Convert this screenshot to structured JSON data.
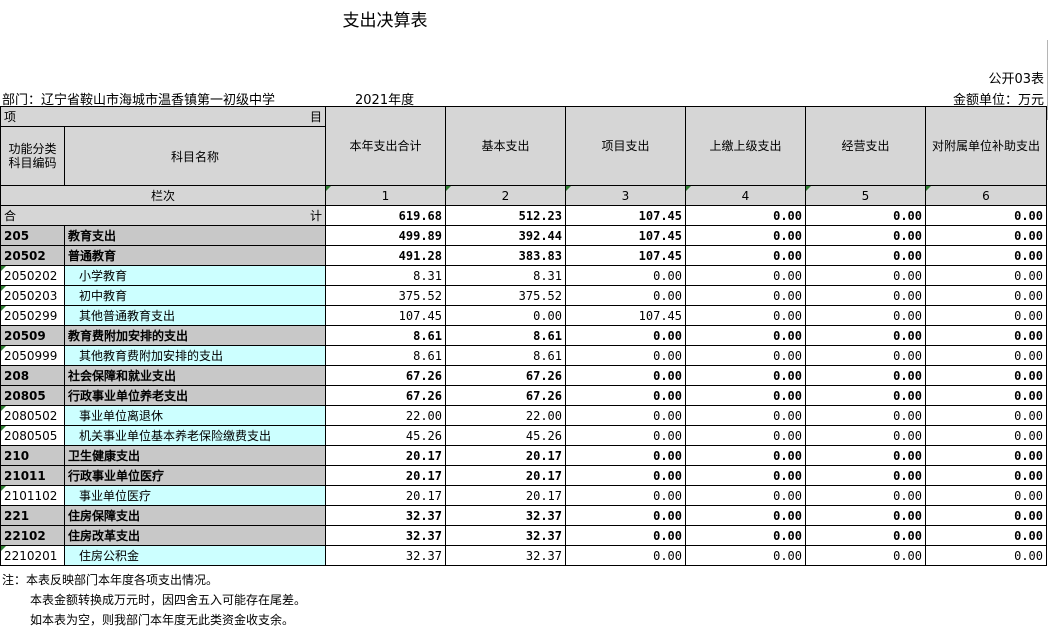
{
  "title": "支出决算表",
  "form_code": "公开03表",
  "department": "部门：辽宁省鞍山市海城市温香镇第一初级中学",
  "year": "2021年度",
  "unit": "金额单位：万元",
  "header": {
    "item_left": "项",
    "item_right": "目",
    "func_code": "功能分类科目编码",
    "subject_name": "科目名称",
    "columns": [
      "本年支出合计",
      "基本支出",
      "项目支出",
      "上缴上级支出",
      "经营支出",
      "对附属单位补助支出"
    ],
    "row_label": "栏次",
    "col_numbers": [
      "1",
      "2",
      "3",
      "4",
      "5",
      "6"
    ]
  },
  "total": {
    "left": "合",
    "right": "计",
    "values": [
      "619.68",
      "512.23",
      "107.45",
      "0.00",
      "0.00",
      "0.00"
    ]
  },
  "rows": [
    {
      "code": "205",
      "name": "教育支出",
      "bold": true,
      "values": [
        "499.89",
        "392.44",
        "107.45",
        "0.00",
        "0.00",
        "0.00"
      ]
    },
    {
      "code": "20502",
      "name": "普通教育",
      "bold": true,
      "values": [
        "491.28",
        "383.83",
        "107.45",
        "0.00",
        "0.00",
        "0.00"
      ]
    },
    {
      "code": "2050202",
      "name": "小学教育",
      "bold": false,
      "values": [
        "8.31",
        "8.31",
        "0.00",
        "0.00",
        "0.00",
        "0.00"
      ]
    },
    {
      "code": "2050203",
      "name": "初中教育",
      "bold": false,
      "values": [
        "375.52",
        "375.52",
        "0.00",
        "0.00",
        "0.00",
        "0.00"
      ]
    },
    {
      "code": "2050299",
      "name": "其他普通教育支出",
      "bold": false,
      "values": [
        "107.45",
        "0.00",
        "107.45",
        "0.00",
        "0.00",
        "0.00"
      ]
    },
    {
      "code": "20509",
      "name": "教育费附加安排的支出",
      "bold": true,
      "values": [
        "8.61",
        "8.61",
        "0.00",
        "0.00",
        "0.00",
        "0.00"
      ]
    },
    {
      "code": "2050999",
      "name": "其他教育费附加安排的支出",
      "bold": false,
      "values": [
        "8.61",
        "8.61",
        "0.00",
        "0.00",
        "0.00",
        "0.00"
      ]
    },
    {
      "code": "208",
      "name": "社会保障和就业支出",
      "bold": true,
      "values": [
        "67.26",
        "67.26",
        "0.00",
        "0.00",
        "0.00",
        "0.00"
      ]
    },
    {
      "code": "20805",
      "name": "行政事业单位养老支出",
      "bold": true,
      "values": [
        "67.26",
        "67.26",
        "0.00",
        "0.00",
        "0.00",
        "0.00"
      ]
    },
    {
      "code": "2080502",
      "name": "事业单位离退休",
      "bold": false,
      "values": [
        "22.00",
        "22.00",
        "0.00",
        "0.00",
        "0.00",
        "0.00"
      ]
    },
    {
      "code": "2080505",
      "name": "机关事业单位基本养老保险缴费支出",
      "bold": false,
      "values": [
        "45.26",
        "45.26",
        "0.00",
        "0.00",
        "0.00",
        "0.00"
      ]
    },
    {
      "code": "210",
      "name": "卫生健康支出",
      "bold": true,
      "values": [
        "20.17",
        "20.17",
        "0.00",
        "0.00",
        "0.00",
        "0.00"
      ]
    },
    {
      "code": "21011",
      "name": "行政事业单位医疗",
      "bold": true,
      "values": [
        "20.17",
        "20.17",
        "0.00",
        "0.00",
        "0.00",
        "0.00"
      ]
    },
    {
      "code": "2101102",
      "name": "事业单位医疗",
      "bold": false,
      "values": [
        "20.17",
        "20.17",
        "0.00",
        "0.00",
        "0.00",
        "0.00"
      ]
    },
    {
      "code": "221",
      "name": "住房保障支出",
      "bold": true,
      "values": [
        "32.37",
        "32.37",
        "0.00",
        "0.00",
        "0.00",
        "0.00"
      ]
    },
    {
      "code": "22102",
      "name": "住房改革支出",
      "bold": true,
      "values": [
        "32.37",
        "32.37",
        "0.00",
        "0.00",
        "0.00",
        "0.00"
      ]
    },
    {
      "code": "2210201",
      "name": "住房公积金",
      "bold": false,
      "values": [
        "32.37",
        "32.37",
        "0.00",
        "0.00",
        "0.00",
        "0.00"
      ]
    }
  ],
  "notes": [
    "注：本表反映部门本年度各项支出情况。",
    "本表金额转换成万元时，因四舍五入可能存在尾差。",
    "如本表为空，则我部门本年度无此类资金收支余。"
  ]
}
